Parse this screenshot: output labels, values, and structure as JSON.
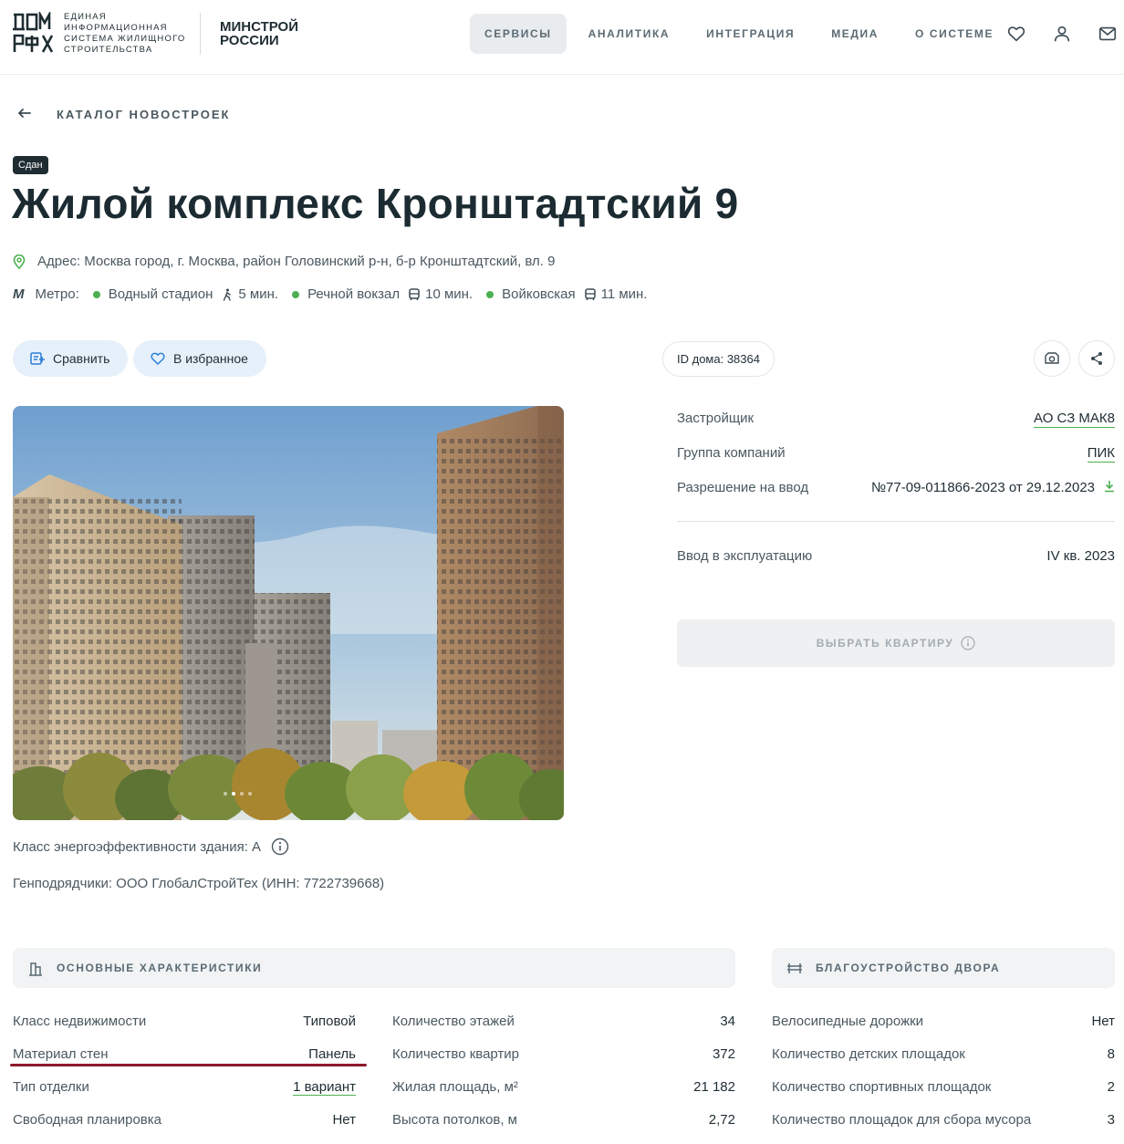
{
  "header": {
    "logo_text": "ЕДИНАЯ\nИНФОРМАЦИОННАЯ\nСИСТЕМА ЖИЛИЩНОГО\nСТРОИТЕЛЬСТВА",
    "ministry": "МИНСТРОЙ\nРОССИИ",
    "nav": [
      {
        "label": "СЕРВИСЫ",
        "active": true
      },
      {
        "label": "АНАЛИТИКА"
      },
      {
        "label": "ИНТЕГРАЦИЯ"
      },
      {
        "label": "МЕДИА"
      },
      {
        "label": "О СИСТЕМЕ"
      }
    ],
    "icons": [
      "heart-icon",
      "user-icon",
      "mail-icon"
    ]
  },
  "breadcrumb": "КАТАЛОГ НОВОСТРОЕК",
  "status_badge": "Сдан",
  "title": "Жилой комплекс Кронштадтский 9",
  "address": "Адрес: Москва город, г. Москва, район Головинский р-н, б-р Кронштадтский, вл. 9",
  "metro": {
    "label": "Метро:",
    "stations": [
      {
        "name": "Водный стадион",
        "time": "5 мин.",
        "mode": "walk"
      },
      {
        "name": "Речной вокзал",
        "time": "10 мин.",
        "mode": "bus"
      },
      {
        "name": "Войковская",
        "time": "11 мин.",
        "mode": "bus"
      }
    ]
  },
  "actions": {
    "compare": "Сравнить",
    "favorite": "В избранное",
    "house_id": "ID дома: 38364"
  },
  "info": {
    "developer_label": "Застройщик",
    "developer": "АО СЗ МАК8",
    "group_label": "Группа компаний",
    "group": "ПИК",
    "permit_label": "Разрешение на ввод",
    "permit": "№77-09-011866-2023 от 29.12.2023",
    "commission_label": "Ввод в эксплуатацию",
    "commission": "IV кв. 2023",
    "choose_button": "ВЫБРАТЬ КВАРТИРУ"
  },
  "energy": "Класс энергоэффективности здания: A",
  "contractor": "Генподрядчики: ООО ГлобалСтройТех (ИНН: 7722739668)",
  "main_chars": {
    "title": "ОСНОВНЫЕ ХАРАКТЕРИСТИКИ",
    "col1": [
      {
        "label": "Класс недвижимости",
        "value": "Типовой"
      },
      {
        "label": "Материал стен",
        "value": "Панель"
      },
      {
        "label": "Тип отделки",
        "value": "1 вариант"
      },
      {
        "label": "Свободная планировка",
        "value": "Нет"
      }
    ],
    "col2": [
      {
        "label": "Количество этажей",
        "value": "34"
      },
      {
        "label": "Количество квартир",
        "value": "372"
      },
      {
        "label": "Жилая площадь, м²",
        "value": "21 182"
      },
      {
        "label": "Высота потолков, м",
        "value": "2,72"
      }
    ]
  },
  "yard": {
    "title": "БЛАГОУСТРОЙСТВО ДВОРА",
    "rows": [
      {
        "label": "Велосипедные дорожки",
        "value": "Нет"
      },
      {
        "label": "Количество детских площадок",
        "value": "8"
      },
      {
        "label": "Количество спортивных площадок",
        "value": "2"
      },
      {
        "label": "Количество площадок для сбора мусора",
        "value": "3"
      }
    ]
  }
}
